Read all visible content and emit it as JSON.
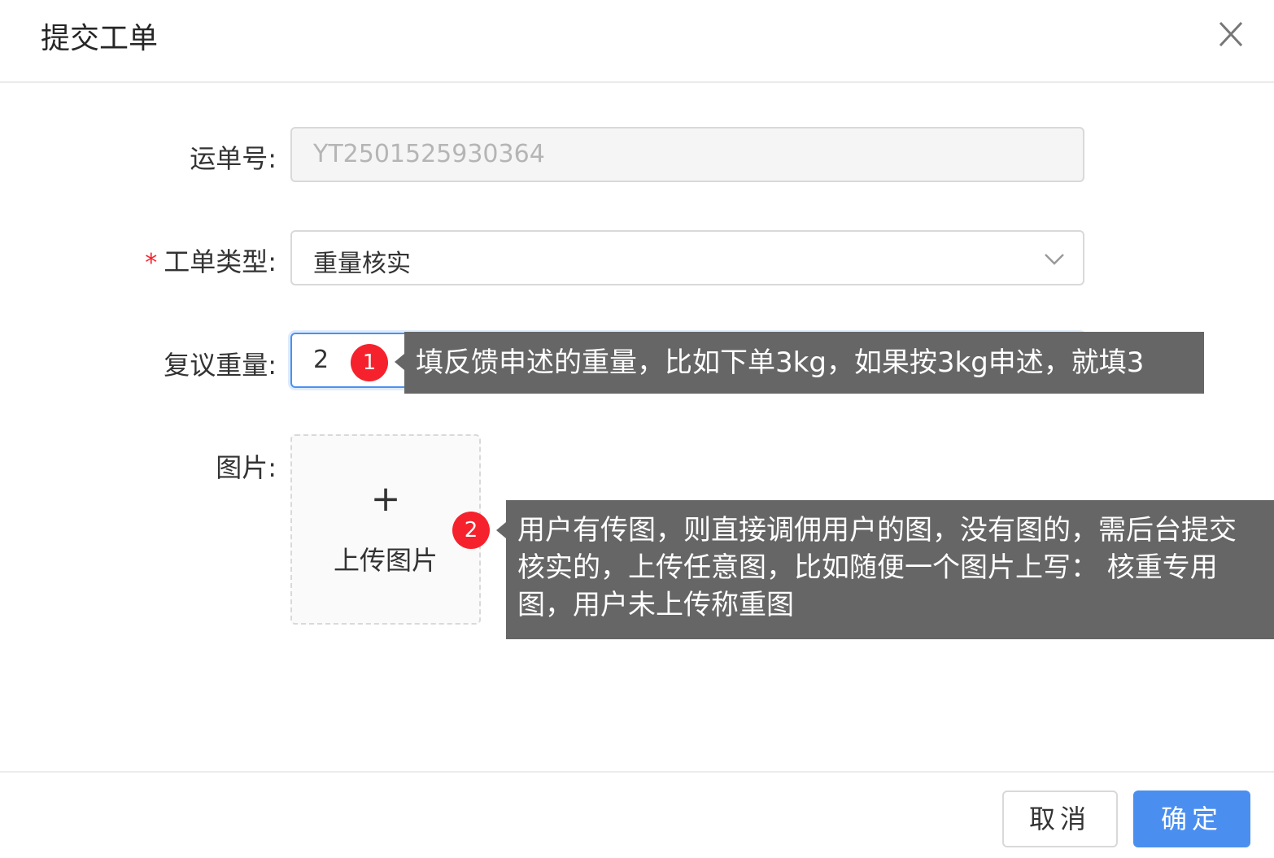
{
  "dialog": {
    "title": "提交工单",
    "close_icon": "close-icon"
  },
  "form": {
    "waybill": {
      "label": "运单号:",
      "value": "YT2501525930364",
      "disabled": true
    },
    "ticket_type": {
      "required_mark": "*",
      "label": "工单类型:",
      "value": "重量核实",
      "icon": "chevron-down-icon"
    },
    "review_weight": {
      "label": "复议重量:",
      "value": "2"
    },
    "images": {
      "label": "图片:",
      "plus_glyph": "+",
      "upload_label": "上传图片"
    }
  },
  "annotations": [
    {
      "badge": "1",
      "text": "填反馈申述的重量，比如下单3kg，如果按3kg申述，就填3"
    },
    {
      "badge": "2",
      "text": "用户有传图，则直接调佣用户的图，没有图的，需后台提交核实的，上传任意图，比如随便一个图片上写： 核重专用图，用户未上传称重图"
    }
  ],
  "footer": {
    "cancel_label": "取消",
    "ok_label": "确定"
  },
  "colors": {
    "primary": "#4a8ff0",
    "required": "#f5222d",
    "badge": "#f5222d",
    "tooltip_bg": "#666666"
  }
}
